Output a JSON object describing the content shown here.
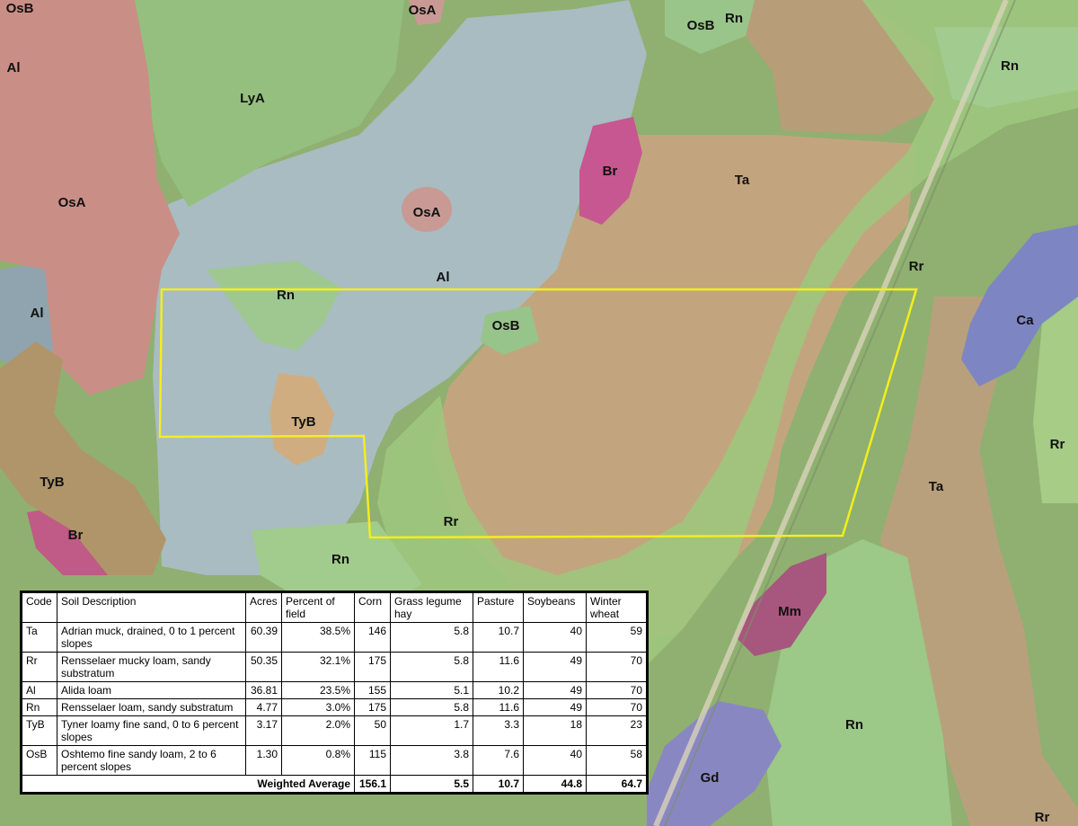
{
  "map": {
    "soil_labels": [
      {
        "code": "OsB",
        "id": "osb-topleft"
      },
      {
        "code": "OsA",
        "id": "osa-top"
      },
      {
        "code": "OsB",
        "id": "osb-topright"
      },
      {
        "code": "Rn",
        "id": "rn-top"
      },
      {
        "code": "Rn",
        "id": "rn-topright"
      },
      {
        "code": "Al",
        "id": "al-topleft"
      },
      {
        "code": "LyA",
        "id": "lya"
      },
      {
        "code": "Br",
        "id": "br-top"
      },
      {
        "code": "Ta",
        "id": "ta-top"
      },
      {
        "code": "OsA",
        "id": "osa-left"
      },
      {
        "code": "OsA",
        "id": "osa-center"
      },
      {
        "code": "Rr",
        "id": "rr-right"
      },
      {
        "code": "Al",
        "id": "al-center"
      },
      {
        "code": "Rn",
        "id": "rn-field"
      },
      {
        "code": "Al",
        "id": "al-left"
      },
      {
        "code": "OsB",
        "id": "osb-field"
      },
      {
        "code": "Ca",
        "id": "ca"
      },
      {
        "code": "TyB",
        "id": "tyb-field"
      },
      {
        "code": "Rr",
        "id": "rr-farright"
      },
      {
        "code": "TyB",
        "id": "tyb-left"
      },
      {
        "code": "Ta",
        "id": "ta-right"
      },
      {
        "code": "Br",
        "id": "br-left"
      },
      {
        "code": "Rr",
        "id": "rr-field"
      },
      {
        "code": "Rn",
        "id": "rn-bottom"
      },
      {
        "code": "Mm",
        "id": "mm"
      },
      {
        "code": "Rn",
        "id": "rn-bottomright"
      },
      {
        "code": "Gd",
        "id": "gd"
      },
      {
        "code": "Rr",
        "id": "rr-corner"
      }
    ],
    "colors": {
      "field_boundary": "#f2ee1e",
      "Ta": "#c9a77e",
      "Rr": "#9fc47a",
      "Al": "#a9bdc8",
      "Rn": "#93c28a",
      "OsA": "#d99a9a",
      "Br": "#c0508a",
      "Ca": "#7f87c6",
      "Mm": "#a0527a",
      "Gd": "#8a86c4",
      "TyB": "#d0aa7a"
    }
  },
  "table": {
    "headers": [
      "Code",
      "Soil Description",
      "Acres",
      "Percent of field",
      "Corn",
      "Grass legume hay",
      "Pasture",
      "Soybeans",
      "Winter wheat"
    ],
    "rows": [
      [
        "Ta",
        "Adrian muck, drained, 0 to 1 percent slopes",
        "60.39",
        "38.5%",
        "146",
        "5.8",
        "10.7",
        "40",
        "59"
      ],
      [
        "Rr",
        "Rensselaer mucky loam, sandy substratum",
        "50.35",
        "32.1%",
        "175",
        "5.8",
        "11.6",
        "49",
        "70"
      ],
      [
        "Al",
        "Alida loam",
        "36.81",
        "23.5%",
        "155",
        "5.1",
        "10.2",
        "49",
        "70"
      ],
      [
        "Rn",
        "Rensselaer loam, sandy substratum",
        "4.77",
        "3.0%",
        "175",
        "5.8",
        "11.6",
        "49",
        "70"
      ],
      [
        "TyB",
        "Tyner loamy fine sand, 0 to 6 percent slopes",
        "3.17",
        "2.0%",
        "50",
        "1.7",
        "3.3",
        "18",
        "23"
      ],
      [
        "OsB",
        "Oshtemo fine sandy loam, 2 to 6 percent slopes",
        "1.30",
        "0.8%",
        "115",
        "3.8",
        "7.6",
        "40",
        "58"
      ]
    ],
    "average": {
      "label": "Weighted Average",
      "corn": "156.1",
      "hay": "5.5",
      "pasture": "10.7",
      "soybeans": "44.8",
      "wheat": "64.7"
    }
  }
}
